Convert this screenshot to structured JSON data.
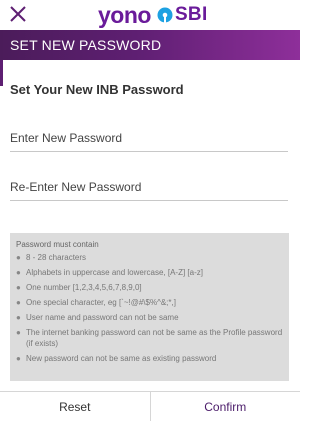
{
  "app": {
    "logo_text": "yono",
    "logo_brand": "SBI"
  },
  "header": {
    "title": "SET NEW PASSWORD"
  },
  "form": {
    "title": "Set Your New INB Password",
    "new_password_placeholder": "Enter New Password",
    "reenter_password_placeholder": "Re-Enter New Password"
  },
  "rules": {
    "heading": "Password must contain",
    "items": [
      "8 - 28 characters",
      "Alphabets in uppercase and lowercase, [A-Z] [a-z]",
      "One number [1,2,3,4,5,6,7,8,9,0]",
      "One special character, eg [`~!@#\\$%^&;*,]",
      "User name and password can not be same",
      "The internet banking password can not be same as the Profile password (if exists)",
      "New password can not be same as existing password"
    ]
  },
  "footer": {
    "reset_label": "Reset",
    "confirm_label": "Confirm"
  },
  "colors": {
    "brand_purple": "#6a1b9a",
    "header_start": "#4b1c5a",
    "header_end": "#8e2f9a",
    "rules_background": "#dcdcdc"
  }
}
